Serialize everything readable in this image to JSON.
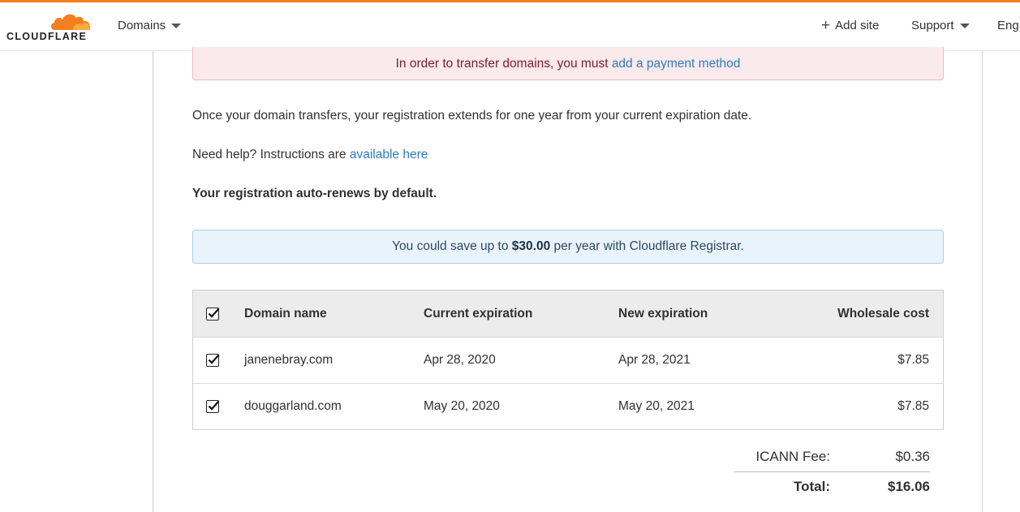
{
  "brand": {
    "name": "CLOUDFLARE",
    "accent_color": "#f38020"
  },
  "nav": {
    "domains_label": "Domains",
    "add_site_label": "Add site",
    "support_label": "Support",
    "language_label": "Eng"
  },
  "alerts": {
    "payment": {
      "text": "In order to transfer domains, you must ",
      "link": "add a payment method"
    },
    "savings": {
      "prefix": "You could save up to ",
      "amount": "$30.00",
      "suffix": " per year with Cloudflare Registrar."
    }
  },
  "info": {
    "transfer_text": "Once your domain transfers, your registration extends for one year from your current expiration date.",
    "help_prefix": "Need help? Instructions are ",
    "help_link": "available here",
    "auto_renew": "Your registration auto-renews by default."
  },
  "table": {
    "headers": {
      "domain": "Domain name",
      "current": "Current expiration",
      "new": "New expiration",
      "cost": "Wholesale cost"
    },
    "rows": [
      {
        "domain": "janenebray.com",
        "current": "Apr 28, 2020",
        "new": "Apr 28, 2021",
        "cost": "$7.85",
        "checked": true
      },
      {
        "domain": "douggarland.com",
        "current": "May 20, 2020",
        "new": "May 20, 2021",
        "cost": "$7.85",
        "checked": true
      }
    ]
  },
  "summary": {
    "icann_label": "ICANN Fee:",
    "icann_value": "$0.36",
    "total_label": "Total:",
    "total_value": "$16.06"
  }
}
